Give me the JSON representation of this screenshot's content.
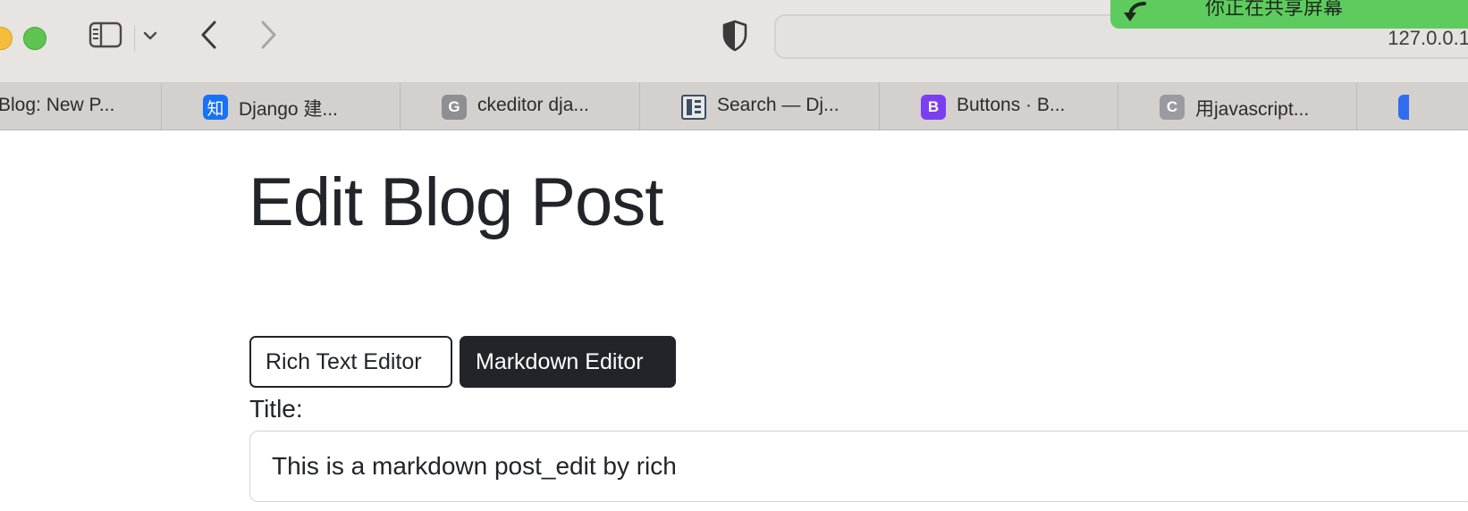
{
  "browser": {
    "url": "127.0.0.1",
    "screen_share_notice": "你正在共享屏幕",
    "tabs": [
      {
        "label": "Blog: New P...",
        "favicon_text": ""
      },
      {
        "label": "Django 建...",
        "favicon_text": "知"
      },
      {
        "label": "ckeditor dja...",
        "favicon_text": "G"
      },
      {
        "label": "Search — Dj...",
        "favicon_text": ""
      },
      {
        "label": "Buttons · B...",
        "favicon_text": "B"
      },
      {
        "label": "用javascript...",
        "favicon_text": "C"
      }
    ],
    "icons": {
      "sidebar": "sidebar-icon",
      "dropdown": "chevron-down-icon",
      "back": "chevron-left-icon",
      "forward": "chevron-right-icon",
      "privacy": "shield-icon"
    },
    "colors": {
      "traffic_yellow": "#f6bd3b",
      "traffic_green": "#5dc351",
      "share_green": "#5ecb5e"
    }
  },
  "page": {
    "title": "Edit Blog Post",
    "editor_toggle": {
      "rich_label": "Rich Text Editor",
      "markdown_label": "Markdown Editor",
      "active": "Markdown Editor"
    },
    "form": {
      "title_label": "Title:",
      "title_value": "This is a markdown post_edit by rich"
    }
  }
}
